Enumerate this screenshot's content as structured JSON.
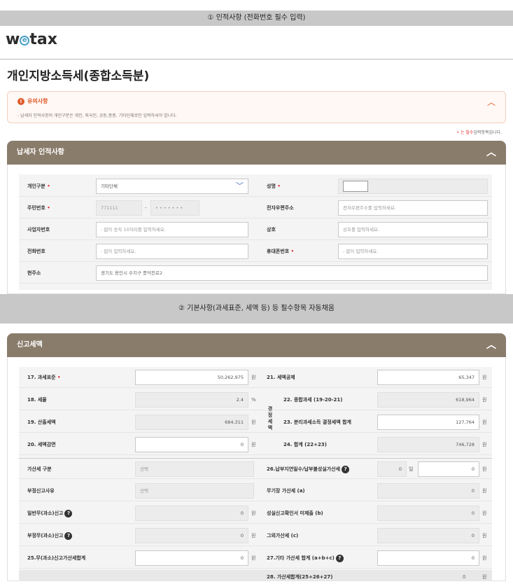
{
  "captions": {
    "step1": "① 인적사항 (전화번호 필수 입력)",
    "step2": "② 기본사항(과세표준, 세액 등) 등 필수항목 자동채움"
  },
  "header": {
    "logo_left": "w",
    "logo_e": "e",
    "logo_right": "tax",
    "page_title": "개인지방소득세(종합소득분)"
  },
  "notice": {
    "title": "유의사항",
    "desc": "- 납세자 인적사항의 개인구분은 개인, 외국인, 공동,종중, 기타단체로만 입력하셔야 합니다.",
    "req_prefix": "•",
    "req_word": "는 필수",
    "req_suffix": "입력항목입니다."
  },
  "taxpayer": {
    "title": "납세자 인적사항",
    "fields": {
      "type_label": "개인구분",
      "type_value": "기타단체",
      "name_label": "성명",
      "rrn_label": "주민번호",
      "rrn_front": "771111",
      "rrn_sep": "-",
      "rrn_back": "• • • • • • •",
      "email_label": "전자우편주소",
      "email_placeholder": "전자우편주소를 입력하세요.",
      "biz_label": "사업자번호",
      "biz_placeholder": "- 없이 숫자 10자리를 입력하세요.",
      "company_label": "상호",
      "company_placeholder": "상호를 입력하세요.",
      "phone_label": "전화번호",
      "phone_placeholder": "- 없이 입력하세요.",
      "mobile_label": "휴대폰번호",
      "mobile_placeholder": "- 없이 입력하세요.",
      "address_label": "현주소",
      "address_value": "경기도 용인시 수지구 풍덕천로2"
    }
  },
  "tax": {
    "title": "신고세액",
    "vertical_label": "결정세액",
    "rows": {
      "r17_label": "17. 과세표준",
      "r17_value": "50,262,975",
      "r17_unit": "원",
      "r18_label": "18. 세율",
      "r18_value": "2.4",
      "r18_unit": "%",
      "r19_label": "19. 산출세액",
      "r19_value": "684,311",
      "r19_unit": "원",
      "r20_label": "20. 세액감면",
      "r20_value": "0",
      "r20_unit": "원",
      "r21_label": "21. 세액공제",
      "r21_value": "65,347",
      "r21_unit": "원",
      "r22_label": "22. 종합과세 (19-20-21)",
      "r22_value": "618,964",
      "r22_unit": "원",
      "r23_label": "23. 분리과세소득 결정세액 합계",
      "r23_value": "127,764",
      "r23_unit": "원",
      "r24_label": "24. 합계 (22+23)",
      "r24_value": "746,728",
      "r24_unit": "원",
      "add_type_label": "가산세 구분",
      "add_type_value": "선택",
      "improper_label": "부정신고사유",
      "improper_value": "선택",
      "r26_label": "26.납부지연일수/납부불성실가산세",
      "r26_days": "0",
      "r26_days_unit": "일",
      "r26_value": "0",
      "r26_unit": "원",
      "general_label": "일반무(과소)신고",
      "general_value": "0",
      "general_unit": "원",
      "noledger_label": "무기장 가산세 (a)",
      "noledger_value": "0",
      "noledger_unit": "원",
      "fraud_label": "부정무(과소)신고",
      "fraud_value": "0",
      "fraud_unit": "원",
      "sincere_label": "성실신고확인서 미제출 (b)",
      "sincere_value": "0",
      "sincere_unit": "원",
      "other_label": "그외가산세 (c)",
      "other_value": "0",
      "other_unit": "원",
      "r25_label": "25.무(과소)신고가산세합계",
      "r25_value": "0",
      "r25_unit": "원",
      "r27_label": "27.기타 가산세 합계 (a+b+c)",
      "r27_value": "0",
      "r27_unit": "원",
      "r28_label": "28. 가산세합계(25+26+27)",
      "r28_value": "0",
      "r28_unit": "원"
    }
  }
}
